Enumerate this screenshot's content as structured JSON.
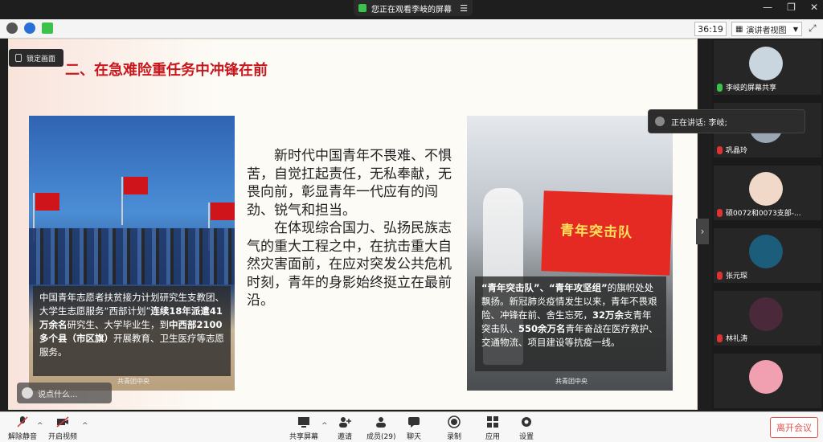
{
  "share_banner": {
    "text": "您正在观看李岐的屏幕"
  },
  "toolbar": {
    "timer": "36:19",
    "view_mode": "演讲者视图"
  },
  "slide": {
    "lock_label": "锁定画面",
    "title": "二、在急难险重任务中冲锋在前",
    "left_caption": {
      "part1": "中国青年志愿者扶贫接力计划研究生支教团、大学生志愿服务“西部计划”",
      "bold1": "连续18年派遣41万余名",
      "part2": "研究生、大学毕业生，到",
      "bold2": "中西部2100多个县（市区旗）",
      "part3": "开展教育、卫生医疗等志愿服务。"
    },
    "center_p1": "新时代中国青年不畏难、不惧苦，自觉扛起责任，无私奉献，无畏向前，彰显青年一代应有的闯劲、锐气和担当。",
    "center_p2": "在体现综合国力、弘扬民族志气的重大工程之中，在抗击重大自然灾害面前，在应对突发公共危机时刻，青年的身影始终挺立在最前沿。",
    "right_banner": "青年突击队",
    "right_caption": {
      "bold1": "“青年突击队”、“青年攻坚组”",
      "part1": "的旗帜处处飘扬。新冠肺炎疫情发生以来，青年不畏艰险、冲锋在前、舍生忘死，",
      "bold2": "32万余",
      "part2": "支青年突击队、",
      "bold3": "550余万名",
      "part3": "青年奋战在医疗救护、交通物流、项目建设等抗疫一线。"
    },
    "watermark": "共青团中央",
    "chat_placeholder": "说点什么..."
  },
  "speaking": {
    "text": "正在讲话: 李岐;"
  },
  "participants": [
    {
      "name": "李岐的屏幕共享",
      "color": "#c9d6e0"
    },
    {
      "name": "巩晶玲",
      "color": "#9aa7b3"
    },
    {
      "name": "硕0072和0073支部-...",
      "color": "#f0d9c8"
    },
    {
      "name": "张元琛",
      "color": "#1b5d7a"
    },
    {
      "name": "林礼涛",
      "color": "#4a2a3a"
    },
    {
      "name": "",
      "color": "#f0a0b0"
    }
  ],
  "bottom_bar": {
    "mute": "解除静音",
    "video": "开启视频",
    "share": "共享屏幕",
    "invite": "邀请",
    "members": "成员(29)",
    "chat": "聊天",
    "record": "录制",
    "apps": "应用",
    "settings": "设置",
    "leave": "离开会议"
  },
  "colors": {
    "title_red": "#c8171d",
    "leave_red": "#e0524a",
    "active_green": "#3cc24a"
  }
}
